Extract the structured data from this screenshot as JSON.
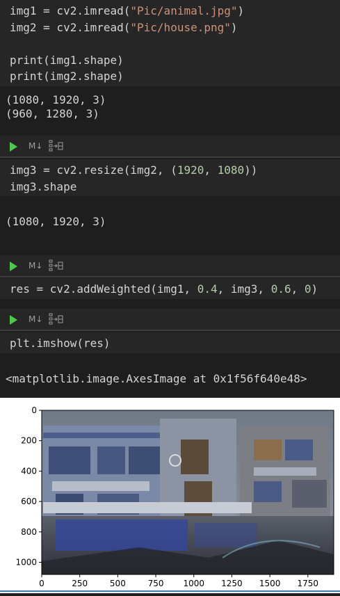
{
  "cells": [
    {
      "id": "cell1",
      "lines": [
        {
          "parts": [
            {
              "t": "img1 = cv2.imread(",
              "c": ""
            },
            {
              "t": "\"Pic/animal.jpg\"",
              "c": "str"
            },
            {
              "t": ")",
              "c": ""
            }
          ]
        },
        {
          "parts": [
            {
              "t": "img2 = cv2.imread(",
              "c": ""
            },
            {
              "t": "\"Pic/house.png\"",
              "c": "str"
            },
            {
              "t": ")",
              "c": ""
            }
          ]
        },
        {
          "parts": [
            {
              "t": "",
              "c": ""
            }
          ]
        },
        {
          "parts": [
            {
              "t": "print(img1.shape)",
              "c": ""
            }
          ]
        },
        {
          "parts": [
            {
              "t": "print(img2.shape)",
              "c": ""
            }
          ]
        }
      ],
      "output": [
        "(1080, 1920, 3)",
        "(960, 1280, 3)"
      ]
    },
    {
      "id": "cell2",
      "lines": [
        {
          "parts": [
            {
              "t": "img3 = cv2.resize(img2, (",
              "c": ""
            },
            {
              "t": "1920",
              "c": "num"
            },
            {
              "t": ", ",
              "c": ""
            },
            {
              "t": "1080",
              "c": "num"
            },
            {
              "t": "))",
              "c": ""
            }
          ]
        },
        {
          "parts": [
            {
              "t": "img3.shape",
              "c": ""
            }
          ]
        }
      ],
      "output": [
        "(1080, 1920, 3)"
      ]
    },
    {
      "id": "cell3",
      "lines": [
        {
          "parts": [
            {
              "t": "res = cv2.addWeighted(img1, ",
              "c": ""
            },
            {
              "t": "0.4",
              "c": "num"
            },
            {
              "t": ", img3, ",
              "c": ""
            },
            {
              "t": "0.6",
              "c": "num"
            },
            {
              "t": ", ",
              "c": ""
            },
            {
              "t": "0",
              "c": "num"
            },
            {
              "t": ")",
              "c": ""
            }
          ]
        }
      ]
    },
    {
      "id": "cell4",
      "lines": [
        {
          "parts": [
            {
              "t": "plt.imshow(res)",
              "c": ""
            }
          ]
        }
      ],
      "output": [
        "<matplotlib.image.AxesImage at 0x1f56f640e48>"
      ]
    }
  ],
  "toolbar": {
    "markdown_label": "M↓",
    "run_icon": "run-cell-icon",
    "split_icon": "split-cell-icon"
  },
  "plot": {
    "y_ticks": [
      "0",
      "200",
      "400",
      "600",
      "800",
      "1000"
    ],
    "x_ticks": [
      "0",
      "250",
      "500",
      "750",
      "1000",
      "1250",
      "1500",
      "1750"
    ],
    "x_range": [
      0,
      1920
    ],
    "y_range": [
      0,
      1080
    ]
  },
  "colors": {
    "background": "#1e1e1e",
    "cell": "#262626",
    "string": "#ce9178",
    "number": "#b5cea8",
    "run": "#4ec94e"
  }
}
